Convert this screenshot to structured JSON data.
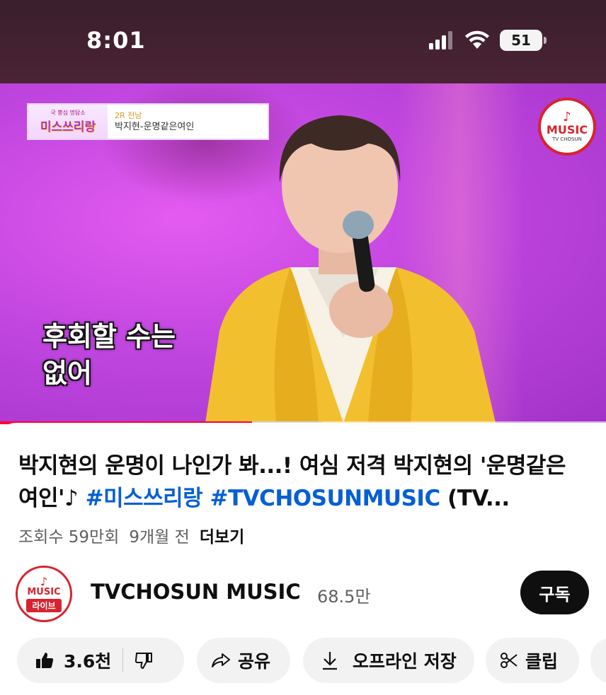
{
  "status": {
    "time": "8:01",
    "battery": "51"
  },
  "video": {
    "caption_show_top": "국 뽕심 명탐소",
    "caption_show": "미스쓰리랑",
    "caption_round": "2R 전남",
    "caption_song": "박지현-운명같은여인",
    "badge_main": "MUSIC",
    "badge_sub": "TV CHOSUN",
    "subtitle_line1": "후회할 수는",
    "subtitle_line2": "없어",
    "progress": 0.416,
    "buffered": 0.53,
    "progress_color": "#ff0033"
  },
  "title": {
    "text": "박지현의 운명이 나인가 봐...! 여심 저격 박지현의 '운명같은 여인'♪ ",
    "hashtag1": "#미스쓰리랑",
    "hashtag2": "#TVCHOSUNMUSIC",
    "tail": " (TV...",
    "hashtag_color": "#065fd4"
  },
  "meta": {
    "views": "조회수 59만회",
    "age": "9개월 전",
    "more": "더보기"
  },
  "channel": {
    "name": "TVCHOSUN MUSIC",
    "subscribers": "68.5만",
    "avatar_main": "MUSIC",
    "avatar_live": "라이브",
    "subscribe_label": "구독"
  },
  "actions": {
    "like_count": "3.6천",
    "share": "공유",
    "download": "오프라인 저장",
    "clip": "클립",
    "icons": [
      "thumbs-up-icon",
      "thumbs-down-icon",
      "share-icon",
      "download-icon",
      "scissors-icon"
    ]
  }
}
